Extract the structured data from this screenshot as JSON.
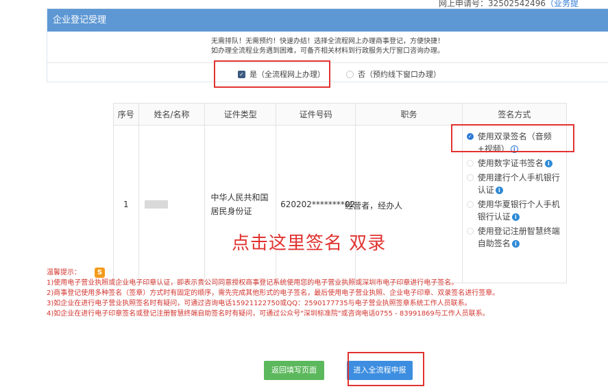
{
  "top": {
    "apply_no": "网上申请号：32502542496",
    "link": "（业务提"
  },
  "panel": {
    "title": "企业登记受理",
    "notice_1": "无需排队！无需预约！快速办结！选择全流程网上办理商事登记，方便快捷！",
    "notice_2": "如办理全流程业务遇到困难，可备齐相关材料到行政服务大厅窗口咨询办理。",
    "option_yes": "是（全流程网上办理）",
    "option_no": "否（预约线下窗口办理）"
  },
  "table": {
    "headers": [
      "序号",
      "姓名/名称",
      "证件类型",
      "证件号码",
      "职务",
      "签名方式"
    ],
    "row": {
      "seq": "1",
      "id_type": "中华人民共和国居民身份证",
      "id_no": "620202********02",
      "role": "经营者，经办人"
    },
    "sign_options": [
      "使用双录签名（音频+视频）",
      "使用数字证书签名",
      "使用建行个人手机银行认证",
      "使用华夏银行个人手机银行认证",
      "使用登记注册智慧终端自助签名"
    ]
  },
  "annotation": "点击这里签名 双录",
  "tips": {
    "title": "温馨提示：",
    "lines": [
      "1)使用电子营业执照或企业电子印章认证，即表示贵公司同意授权商事登记系统使用您的电子营业执照或深圳市电子印章进行电子签名。",
      "2)商事登记使用多种签名（签章）方式时有固定的顺序，需先完成其他形式的电子签名，最后使用电子营业执照、企业电子印章、双录签名进行签章。",
      "3)如企业在进行电子营业执照签名时有疑问，可通过咨询电话15921122750或QQ：2590177735与电子营业执照签章系统工作人员联系。",
      "4)如企业在进行电子印章签名或登记注册智慧终端自助签名时有疑问，可通过公众号\"深圳标准院\"或咨询电话0755 - 83991869与工作人员联系。"
    ]
  },
  "buttons": {
    "back": "返回填写页面",
    "submit": "进入全流程申报"
  },
  "colors": {
    "header_blue": "#5e98d4",
    "annotation_red": "#e0322f",
    "back_green": "#5cb85c",
    "submit_blue": "#3d8ee0"
  }
}
